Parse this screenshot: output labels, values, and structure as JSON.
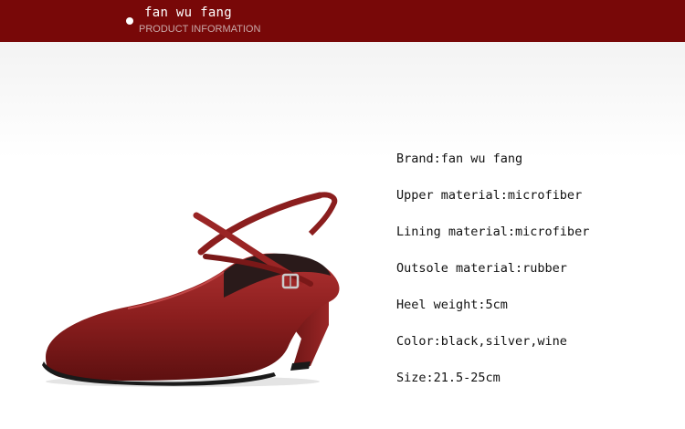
{
  "header": {
    "brand": "fan wu fang",
    "subtitle": "PRODUCT INFORMATION"
  },
  "product_image": {
    "alt": "wine red leather pump with cross ankle strap",
    "color": "#8b1e1e"
  },
  "specs": [
    "Brand:fan wu fang",
    "Upper material:microfiber",
    "Lining material:microfiber",
    "Outsole material:rubber",
    "Heel weight:5cm",
    "Color:black,silver,wine",
    "Size:21.5-25cm"
  ],
  "colors": {
    "header_bg": "#780808",
    "shoe": "#8b1e1e"
  }
}
